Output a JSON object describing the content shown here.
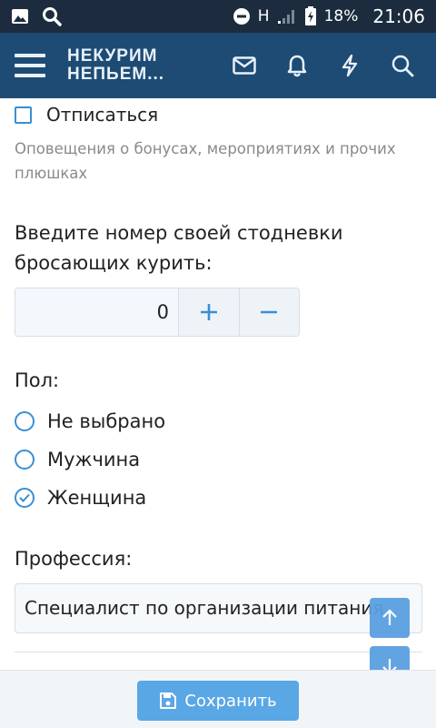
{
  "status_bar": {
    "network": "H",
    "battery": "18%",
    "time": "21:06"
  },
  "header": {
    "logo_line1": "НЕКУРИМ",
    "logo_line2": "НЕПЬЕМ..."
  },
  "notifications": {
    "unsubscribe_label": "Отписаться",
    "unsubscribe_checked": false,
    "hint": "Оповещения о бонусах, мероприятиях и прочих плюшках"
  },
  "day_counter": {
    "label": "Введите номер своей стодневки бросающих курить:",
    "value": "0"
  },
  "gender": {
    "label": "Пол:",
    "options": [
      "Не выбрано",
      "Мужчина",
      "Женщина"
    ],
    "selected": "Женщина"
  },
  "profession": {
    "label": "Профессия:",
    "value": "Специалист по организации питания"
  },
  "footer": {
    "save_label": "Сохранить"
  },
  "colors": {
    "status_bar": "#1c2c3e",
    "header": "#1d4b74",
    "accent": "#3a8fd4",
    "save_button": "#5aa7e6"
  }
}
